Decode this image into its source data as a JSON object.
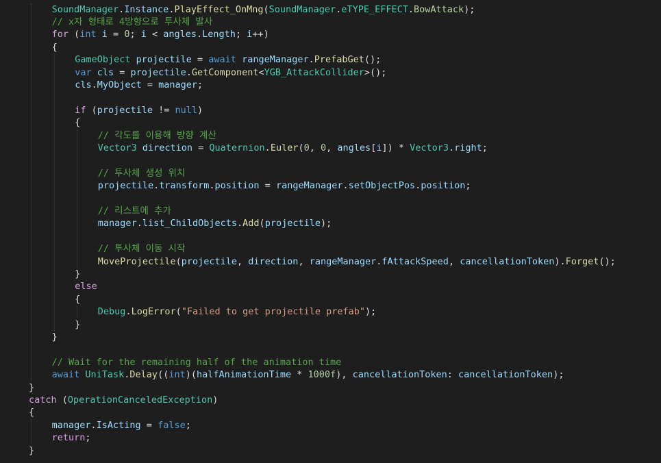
{
  "code_lines": [
    {
      "indent": 4,
      "tokens": [
        [
          "typ",
          "SoundManager"
        ],
        [
          "tx",
          "."
        ],
        [
          "var",
          "Instance"
        ],
        [
          "tx",
          "."
        ],
        [
          "mth",
          "PlayEffect_OnMng"
        ],
        [
          "tx",
          "("
        ],
        [
          "typ",
          "SoundManager"
        ],
        [
          "tx",
          "."
        ],
        [
          "typ",
          "eTYPE_EFFECT"
        ],
        [
          "tx",
          "."
        ],
        [
          "en",
          "BowAttack"
        ],
        [
          "tx",
          ");"
        ]
      ]
    },
    {
      "indent": 4,
      "tokens": [
        [
          "cm",
          "// x자 형태로 4방향으로 투사체 발사"
        ]
      ]
    },
    {
      "indent": 4,
      "tokens": [
        [
          "ctl",
          "for"
        ],
        [
          "tx",
          " ("
        ],
        [
          "kw",
          "int"
        ],
        [
          "tx",
          " "
        ],
        [
          "var",
          "i"
        ],
        [
          "tx",
          " = "
        ],
        [
          "num",
          "0"
        ],
        [
          "tx",
          "; "
        ],
        [
          "var",
          "i"
        ],
        [
          "tx",
          " < "
        ],
        [
          "var",
          "angles"
        ],
        [
          "tx",
          "."
        ],
        [
          "var",
          "Length"
        ],
        [
          "tx",
          "; "
        ],
        [
          "var",
          "i"
        ],
        [
          "tx",
          "++)"
        ]
      ]
    },
    {
      "indent": 4,
      "tokens": [
        [
          "tx",
          "{"
        ]
      ]
    },
    {
      "indent": 8,
      "tokens": [
        [
          "typ",
          "GameObject"
        ],
        [
          "tx",
          " "
        ],
        [
          "var",
          "projectile"
        ],
        [
          "tx",
          " = "
        ],
        [
          "kw",
          "await"
        ],
        [
          "tx",
          " "
        ],
        [
          "var",
          "rangeManager"
        ],
        [
          "tx",
          "."
        ],
        [
          "mth",
          "PrefabGet"
        ],
        [
          "tx",
          "();"
        ]
      ]
    },
    {
      "indent": 8,
      "tokens": [
        [
          "kw",
          "var"
        ],
        [
          "tx",
          " "
        ],
        [
          "var",
          "cls"
        ],
        [
          "tx",
          " = "
        ],
        [
          "var",
          "projectile"
        ],
        [
          "tx",
          "."
        ],
        [
          "mth",
          "GetComponent"
        ],
        [
          "tx",
          "<"
        ],
        [
          "typ",
          "YGB_AttackCollider"
        ],
        [
          "tx",
          ">();"
        ]
      ]
    },
    {
      "indent": 8,
      "tokens": [
        [
          "var",
          "cls"
        ],
        [
          "tx",
          "."
        ],
        [
          "var",
          "MyObject"
        ],
        [
          "tx",
          " = "
        ],
        [
          "var",
          "manager"
        ],
        [
          "tx",
          ";"
        ]
      ]
    },
    {
      "indent": 8,
      "tokens": []
    },
    {
      "indent": 8,
      "tokens": [
        [
          "ctl",
          "if"
        ],
        [
          "tx",
          " ("
        ],
        [
          "var",
          "projectile"
        ],
        [
          "tx",
          " != "
        ],
        [
          "kw",
          "null"
        ],
        [
          "tx",
          ")"
        ]
      ]
    },
    {
      "indent": 8,
      "tokens": [
        [
          "tx",
          "{"
        ]
      ]
    },
    {
      "indent": 12,
      "tokens": [
        [
          "cm",
          "// 각도를 이용해 방향 계산"
        ]
      ]
    },
    {
      "indent": 12,
      "tokens": [
        [
          "typ",
          "Vector3"
        ],
        [
          "tx",
          " "
        ],
        [
          "var",
          "direction"
        ],
        [
          "tx",
          " = "
        ],
        [
          "typ",
          "Quaternion"
        ],
        [
          "tx",
          "."
        ],
        [
          "mth",
          "Euler"
        ],
        [
          "tx",
          "("
        ],
        [
          "num",
          "0"
        ],
        [
          "tx",
          ", "
        ],
        [
          "num",
          "0"
        ],
        [
          "tx",
          ", "
        ],
        [
          "var",
          "angles"
        ],
        [
          "tx",
          "["
        ],
        [
          "var",
          "i"
        ],
        [
          "tx",
          "]) * "
        ],
        [
          "typ",
          "Vector3"
        ],
        [
          "tx",
          "."
        ],
        [
          "var",
          "right"
        ],
        [
          "tx",
          ";"
        ]
      ]
    },
    {
      "indent": 12,
      "tokens": []
    },
    {
      "indent": 12,
      "tokens": [
        [
          "cm",
          "// 투사체 생성 위치"
        ]
      ]
    },
    {
      "indent": 12,
      "tokens": [
        [
          "var",
          "projectile"
        ],
        [
          "tx",
          "."
        ],
        [
          "var",
          "transform"
        ],
        [
          "tx",
          "."
        ],
        [
          "var",
          "position"
        ],
        [
          "tx",
          " = "
        ],
        [
          "var",
          "rangeManager"
        ],
        [
          "tx",
          "."
        ],
        [
          "var",
          "setObjectPos"
        ],
        [
          "tx",
          "."
        ],
        [
          "var",
          "position"
        ],
        [
          "tx",
          ";"
        ]
      ]
    },
    {
      "indent": 12,
      "tokens": []
    },
    {
      "indent": 12,
      "tokens": [
        [
          "cm",
          "// 리스트에 추가"
        ]
      ]
    },
    {
      "indent": 12,
      "tokens": [
        [
          "var",
          "manager"
        ],
        [
          "tx",
          "."
        ],
        [
          "var",
          "list_ChildObjects"
        ],
        [
          "tx",
          "."
        ],
        [
          "mth",
          "Add"
        ],
        [
          "tx",
          "("
        ],
        [
          "var",
          "projectile"
        ],
        [
          "tx",
          ");"
        ]
      ]
    },
    {
      "indent": 12,
      "tokens": []
    },
    {
      "indent": 12,
      "tokens": [
        [
          "cm",
          "// 투사체 이동 시작"
        ]
      ]
    },
    {
      "indent": 12,
      "tokens": [
        [
          "mth",
          "MoveProjectile"
        ],
        [
          "tx",
          "("
        ],
        [
          "var",
          "projectile"
        ],
        [
          "tx",
          ", "
        ],
        [
          "var",
          "direction"
        ],
        [
          "tx",
          ", "
        ],
        [
          "var",
          "rangeManager"
        ],
        [
          "tx",
          "."
        ],
        [
          "var",
          "fAttackSpeed"
        ],
        [
          "tx",
          ", "
        ],
        [
          "var",
          "cancellationToken"
        ],
        [
          "tx",
          ")."
        ],
        [
          "mth",
          "Forget"
        ],
        [
          "tx",
          "();"
        ]
      ]
    },
    {
      "indent": 8,
      "tokens": [
        [
          "tx",
          "}"
        ]
      ]
    },
    {
      "indent": 8,
      "tokens": [
        [
          "ctl",
          "else"
        ]
      ]
    },
    {
      "indent": 8,
      "tokens": [
        [
          "tx",
          "{"
        ]
      ]
    },
    {
      "indent": 12,
      "tokens": [
        [
          "typ",
          "Debug"
        ],
        [
          "tx",
          "."
        ],
        [
          "mth",
          "LogError"
        ],
        [
          "tx",
          "("
        ],
        [
          "str",
          "\"Failed to get projectile prefab\""
        ],
        [
          "tx",
          ");"
        ]
      ]
    },
    {
      "indent": 8,
      "tokens": [
        [
          "tx",
          "}"
        ]
      ]
    },
    {
      "indent": 4,
      "tokens": [
        [
          "tx",
          "}"
        ]
      ]
    },
    {
      "indent": 4,
      "tokens": []
    },
    {
      "indent": 4,
      "tokens": [
        [
          "cm",
          "// Wait for the remaining half of the animation time"
        ]
      ]
    },
    {
      "indent": 4,
      "tokens": [
        [
          "kw",
          "await"
        ],
        [
          "tx",
          " "
        ],
        [
          "typ",
          "UniTask"
        ],
        [
          "tx",
          "."
        ],
        [
          "mth",
          "Delay"
        ],
        [
          "tx",
          "(("
        ],
        [
          "kw",
          "int"
        ],
        [
          "tx",
          ")("
        ],
        [
          "var",
          "halfAnimationTime"
        ],
        [
          "tx",
          " * "
        ],
        [
          "num",
          "1000f"
        ],
        [
          "tx",
          "), "
        ],
        [
          "var",
          "cancellationToken"
        ],
        [
          "tx",
          ": "
        ],
        [
          "var",
          "cancellationToken"
        ],
        [
          "tx",
          ");"
        ]
      ]
    },
    {
      "indent": 0,
      "tokens": [
        [
          "tx",
          "}"
        ]
      ]
    },
    {
      "indent": 0,
      "tokens": [
        [
          "ctl",
          "catch"
        ],
        [
          "tx",
          " ("
        ],
        [
          "typ",
          "OperationCanceledException"
        ],
        [
          "tx",
          ")"
        ]
      ]
    },
    {
      "indent": 0,
      "tokens": [
        [
          "tx",
          "{"
        ]
      ]
    },
    {
      "indent": 4,
      "tokens": [
        [
          "var",
          "manager"
        ],
        [
          "tx",
          "."
        ],
        [
          "var",
          "IsActing"
        ],
        [
          "tx",
          " = "
        ],
        [
          "kw",
          "false"
        ],
        [
          "tx",
          ";"
        ]
      ]
    },
    {
      "indent": 4,
      "tokens": [
        [
          "ctl",
          "return"
        ],
        [
          "tx",
          ";"
        ]
      ]
    },
    {
      "indent": 0,
      "tokens": [
        [
          "tx",
          "}"
        ]
      ]
    }
  ],
  "colors": {
    "background": "#1e1e1e",
    "keyword": "#569cd6",
    "control": "#d8a0df",
    "type": "#4ec9b0",
    "method": "#dcdcaa",
    "variable": "#9cdcfe",
    "number": "#b5cea8",
    "string": "#d69d85",
    "comment": "#57a64a",
    "enum": "#b8d7a3",
    "plain": "#dcdcdc"
  }
}
